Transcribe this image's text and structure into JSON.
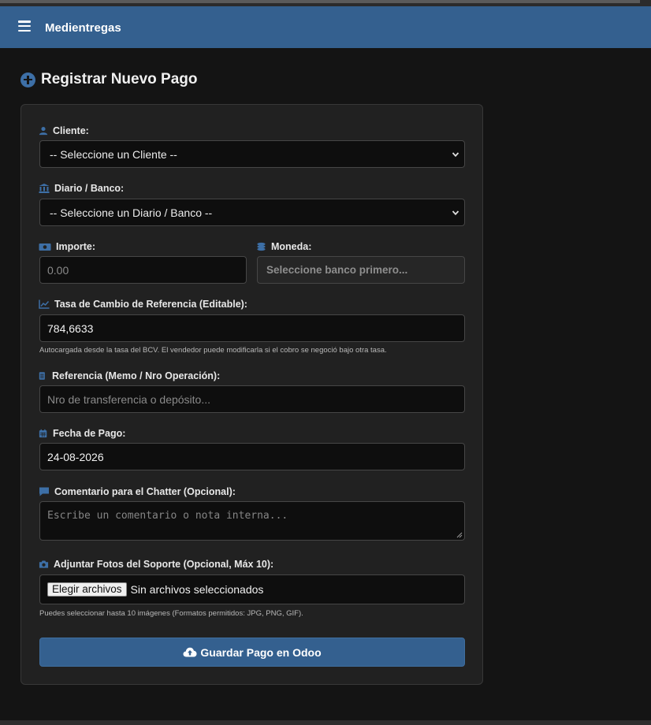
{
  "app": {
    "brand": "Medientregas"
  },
  "page": {
    "title": "Registrar Nuevo Pago"
  },
  "form": {
    "cliente": {
      "label": "Cliente:",
      "selected": "-- Seleccione un Cliente --"
    },
    "diario": {
      "label": "Diario / Banco:",
      "selected": "-- Seleccione un Diario / Banco --"
    },
    "importe": {
      "label": "Importe:",
      "placeholder": "0.00"
    },
    "moneda": {
      "label": "Moneda:",
      "value": "Seleccione banco primero..."
    },
    "tasa": {
      "label": "Tasa de Cambio de Referencia (Editable):",
      "value": "784,6633",
      "help": "Autocargada desde la tasa del BCV. El vendedor puede modificarla si el cobro se negoció bajo otra tasa."
    },
    "referencia": {
      "label": "Referencia (Memo / Nro Operación):",
      "placeholder": "Nro de transferencia o depósito..."
    },
    "fecha": {
      "label": "Fecha de Pago:",
      "value": "24-08-2026"
    },
    "comentario": {
      "label": "Comentario para el Chatter (Opcional):",
      "placeholder": "Escribe un comentario o nota interna..."
    },
    "fotos": {
      "label": "Adjuntar Fotos del Soporte (Opcional, Máx 10):",
      "button": "Elegir archivos",
      "status": "Sin archivos seleccionados",
      "help": "Puedes seleccionar hasta 10 imágenes (Formatos permitidos: JPG, PNG, GIF)."
    },
    "submit": {
      "label": "Guardar Pago en Odoo"
    }
  },
  "colors": {
    "accent": "#34608f",
    "background": "#141414",
    "card": "#212121",
    "input": "#0e0e0e"
  },
  "icons": {
    "menu": "hamburger-icon",
    "title": "plus-circle-icon",
    "cliente": "user-icon",
    "diario": "bank-icon",
    "importe": "money-bill-icon",
    "moneda": "coins-icon",
    "tasa": "chart-line-icon",
    "referencia": "file-text-icon",
    "fecha": "calendar-icon",
    "comentario": "comment-icon",
    "fotos": "camera-icon",
    "submit": "cloud-upload-icon"
  }
}
